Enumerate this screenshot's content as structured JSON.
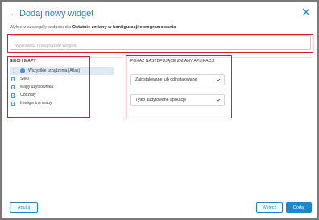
{
  "header": {
    "back_glyph": "←",
    "title": "Dodaj nowy widget",
    "close_icon": "close-icon"
  },
  "subtitle": {
    "prefix": "Wybierz szczegóły widgetu dla ",
    "bold": "Ostatnie zmiany w konfiguracji oprogramowania"
  },
  "name_input": {
    "placeholder": "Wprowadź nową nazwę widgetu",
    "value": ""
  },
  "tree": {
    "title": "SIECI I MAPY",
    "items": [
      {
        "label": "Wszystkie urządzenia (Atlas)",
        "selected": true,
        "icon": "globe-icon"
      },
      {
        "label": "Sieci",
        "selected": false,
        "icon": "expand-icon"
      },
      {
        "label": "Mapy użytkownika",
        "selected": false,
        "icon": "expand-icon"
      },
      {
        "label": "Oddziały",
        "selected": false,
        "icon": "expand-icon"
      },
      {
        "label": "Inteligentne mapy",
        "selected": false,
        "icon": "expand-icon"
      }
    ]
  },
  "changes": {
    "title": "POKAŻ NASTĘPUJĄCE ZMIANY APLIKACJI",
    "select1": "Zainstalowane lub odinstalowane",
    "select2": "Tylko audytowane aplikacje"
  },
  "footer": {
    "cancel": "Anuluj",
    "back": "Wstecz",
    "add": "Dodaj"
  },
  "colors": {
    "accent": "#1a88c9",
    "highlight_box": "#d6202a",
    "selected_row": "#dfe9f4"
  }
}
